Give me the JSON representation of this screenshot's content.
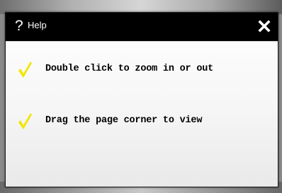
{
  "dialog": {
    "title_icon": "help-icon",
    "title_icon_glyph": "?",
    "title": "Help",
    "close_icon": "close-icon"
  },
  "tips": [
    {
      "icon": "checkmark-icon",
      "text": "Double click to zoom in or out"
    },
    {
      "icon": "checkmark-icon",
      "text": "Drag the page corner to view"
    }
  ],
  "colors": {
    "titlebar": "#000000",
    "title_text": "#ffffff",
    "checkmark": "#f2e600",
    "body_text": "#000000"
  }
}
